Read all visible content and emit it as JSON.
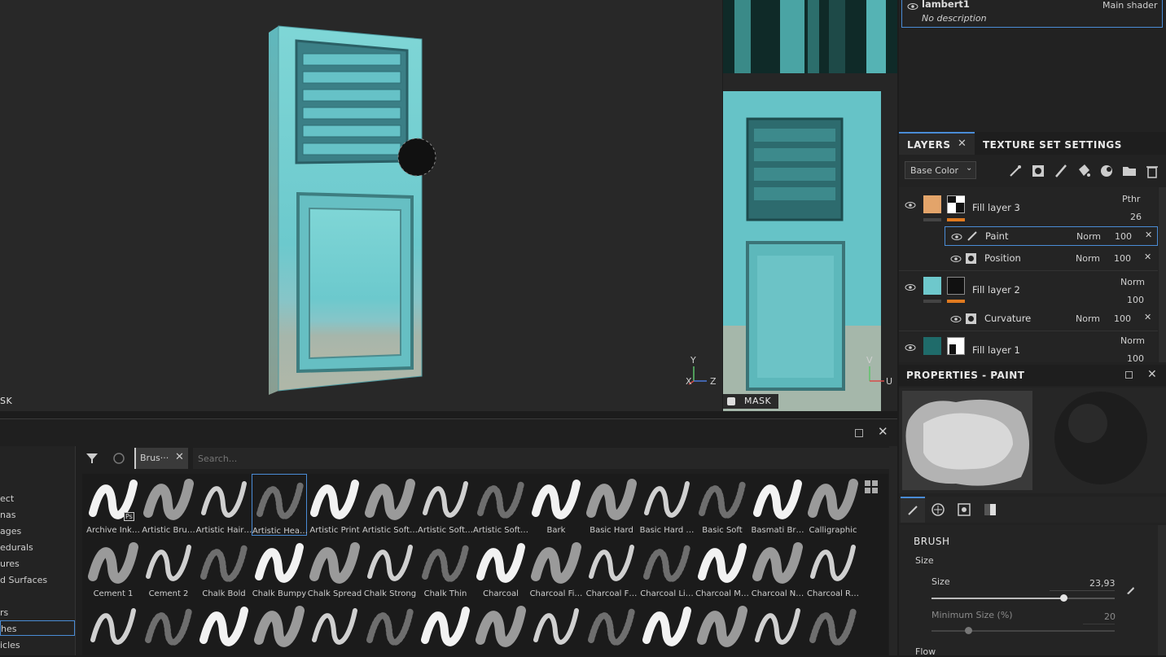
{
  "viewport3d": {
    "mask_label": "SK",
    "axes": {
      "y": "Y",
      "x": "X",
      "z": "Z"
    }
  },
  "viewport2d": {
    "mask_label": "MASK",
    "axes": {
      "v": "V",
      "u": "U"
    }
  },
  "shader": {
    "name": "lambert1",
    "type": "Main shader",
    "description": "No description"
  },
  "layers_panel": {
    "tab_layers": "LAYERS",
    "tab_texture_set": "TEXTURE SET SETTINGS",
    "channel_select": "Base Color",
    "layers": [
      {
        "name": "Fill layer 3",
        "blend": "Pthr",
        "opacity": "26"
      },
      {
        "name": "Paint",
        "blend": "Norm",
        "opacity": "100"
      },
      {
        "name": "Position",
        "blend": "Norm",
        "opacity": "100"
      },
      {
        "name": "Fill layer 2",
        "blend": "Norm",
        "opacity": "100"
      },
      {
        "name": "Curvature",
        "blend": "Norm",
        "opacity": "100"
      },
      {
        "name": "Fill layer 1",
        "blend": "Norm",
        "opacity": "100"
      }
    ]
  },
  "properties": {
    "title": "PROPERTIES - PAINT",
    "section": "BRUSH",
    "size_group": "Size",
    "size_label": "Size",
    "size_value": "23,93",
    "size_fraction": 0.72,
    "min_size_label": "Minimum Size (%)",
    "min_size_value": "20",
    "min_size_fraction": 0.2,
    "flow_label": "Flow"
  },
  "shelf": {
    "search_tag": "Brus···",
    "search_placeholder": "Search...",
    "categories": [
      "ect",
      "nas",
      "ages",
      "edurals",
      "ures",
      "d Surfaces",
      "",
      "rs",
      "hes",
      "icles"
    ],
    "selected_category": 8,
    "brushes_row1": [
      "Archive Ink…",
      "Artistic Bru…",
      "Artistic Hair…",
      "Artistic Hea…",
      "Artistic Print",
      "Artistic Soft…",
      "Artistic Soft…",
      "Artistic Soft…",
      "Bark",
      "Basic Hard",
      "Basic Hard …",
      "Basic Soft",
      "Basmati Br…",
      "Calligraphic"
    ],
    "brushes_row2": [
      "Cement 1",
      "Cement 2",
      "Chalk Bold",
      "Chalk Bumpy",
      "Chalk Spread",
      "Chalk Strong",
      "Chalk Thin",
      "Charcoal",
      "Charcoal Fi…",
      "Charcoal F…",
      "Charcoal Li…",
      "Charcoal M…",
      "Charcoal N…",
      "Charcoal R…"
    ],
    "selected_brush": 3,
    "ps_badge": "Ps"
  }
}
